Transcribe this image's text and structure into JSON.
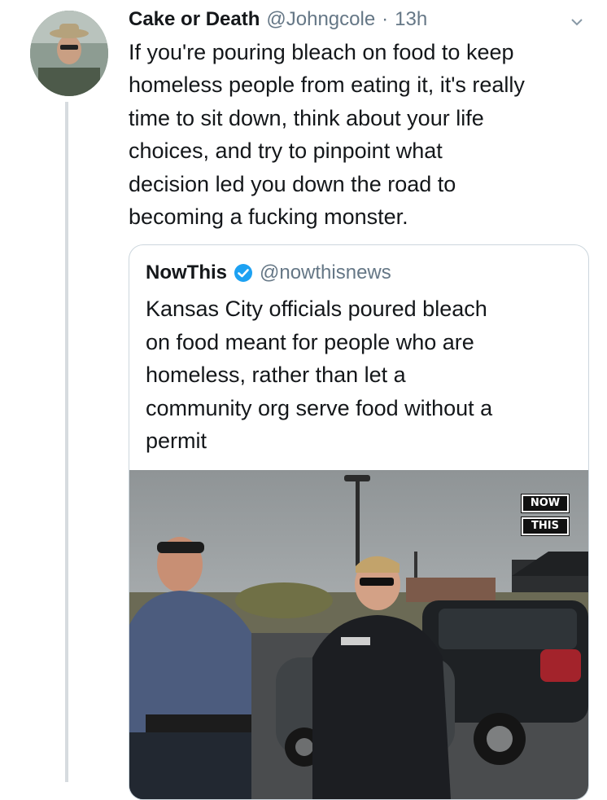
{
  "tweet": {
    "author_name": "Cake or Death",
    "author_handle": "@Johngcole",
    "separator": "·",
    "time": "13h",
    "text_lines": [
      "If you're pouring bleach on food to keep",
      "homeless people from eating it, it's really",
      "time to sit down, think about your life",
      "choices, and try to pinpoint what",
      "decision led you down the road to",
      "becoming a fucking monster."
    ]
  },
  "quoted_tweet": {
    "author_name": "NowThis",
    "verified": true,
    "author_handle": "@nowthisnews",
    "text_lines": [
      "Kansas City officials poured bleach",
      "on food meant for people who are",
      "homeless, rather than let a",
      "community org serve food without a",
      "permit"
    ],
    "media_watermark": [
      "NOW",
      "THIS"
    ]
  },
  "colors": {
    "text": "#14171a",
    "secondary": "#657786",
    "verified": "#1da1f2",
    "border": "#ccd6dd"
  },
  "icons": {
    "menu": "chevron-down-icon",
    "verified": "verified-badge-icon"
  }
}
